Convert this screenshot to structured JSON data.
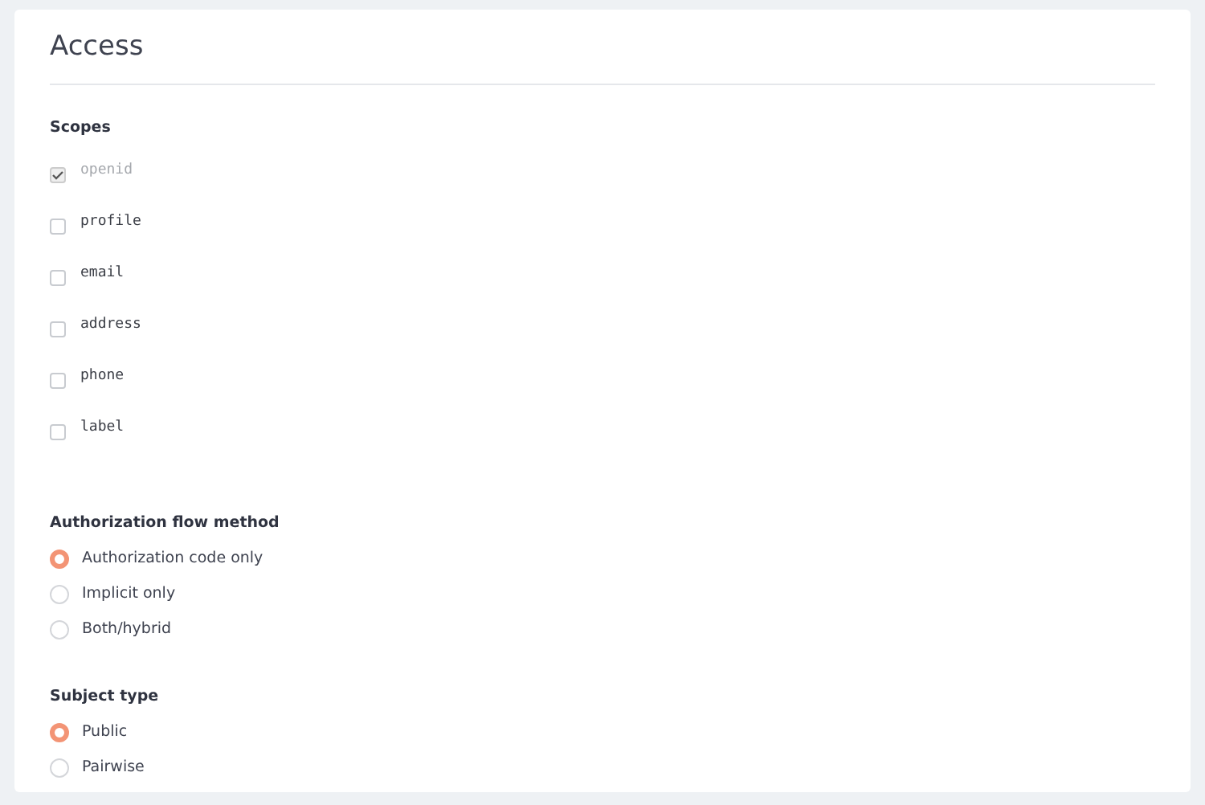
{
  "title": "Access",
  "scopes": {
    "heading": "Scopes",
    "items": [
      {
        "label": "openid",
        "checked": true,
        "disabled": true
      },
      {
        "label": "profile",
        "checked": false,
        "disabled": false
      },
      {
        "label": "email",
        "checked": false,
        "disabled": false
      },
      {
        "label": "address",
        "checked": false,
        "disabled": false
      },
      {
        "label": "phone",
        "checked": false,
        "disabled": false
      },
      {
        "label": "label",
        "checked": false,
        "disabled": false
      }
    ]
  },
  "flow_method": {
    "heading": "Authorization flow method",
    "options": [
      {
        "label": "Authorization code only",
        "selected": true
      },
      {
        "label": "Implicit only",
        "selected": false
      },
      {
        "label": "Both/hybrid",
        "selected": false
      }
    ]
  },
  "subject_type": {
    "heading": "Subject type",
    "options": [
      {
        "label": "Public",
        "selected": true
      },
      {
        "label": "Pairwise",
        "selected": false
      }
    ]
  }
}
